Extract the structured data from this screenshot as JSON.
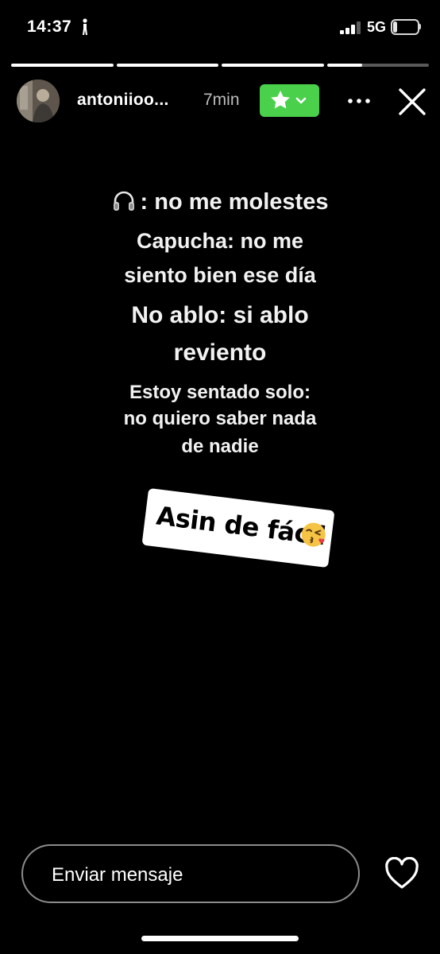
{
  "status_bar": {
    "time": "14:37",
    "network": "5G",
    "battery_level": "18",
    "battery_fraction": 0.18,
    "signal_bars": 3,
    "icons": [
      "walking-person-icon",
      "signal-icon",
      "battery-icon"
    ]
  },
  "story": {
    "progress_segments": [
      1.0,
      1.0,
      1.0,
      0.35
    ],
    "username": "antoniioo...",
    "time_ago": "7min",
    "close_friends_color": "#4bd04b",
    "lines": [
      ": no me molestes",
      "Capucha: no me",
      "siento bien ese día",
      "No ablo: si ablo",
      "reviento",
      "Estoy sentado solo:",
      "no quiero saber nada",
      "de nadie"
    ],
    "sticker_text": "Asin de fácil"
  },
  "footer": {
    "message_placeholder": "Enviar mensaje"
  }
}
